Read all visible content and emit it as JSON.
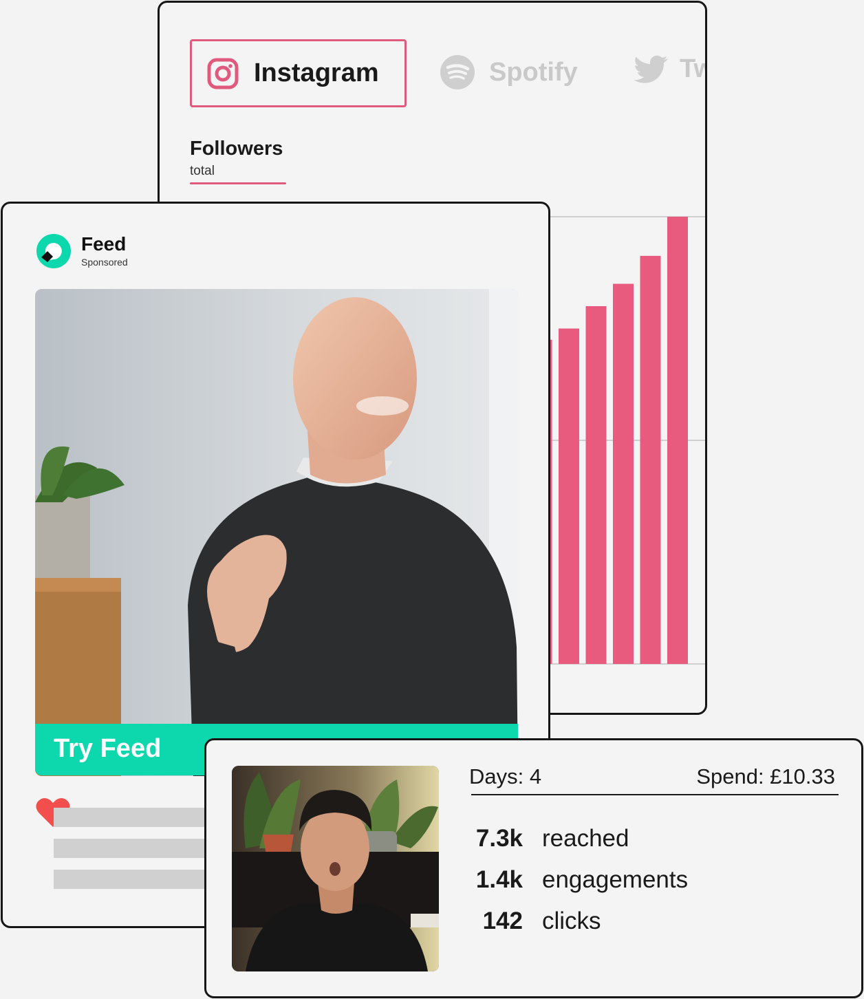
{
  "analytics": {
    "tabs": [
      {
        "label": "Instagram",
        "icon": "instagram-icon",
        "active": true
      },
      {
        "label": "Spotify",
        "icon": "spotify-icon",
        "active": false
      },
      {
        "label": "Tw",
        "icon": "twitter-icon",
        "active": false
      }
    ],
    "metric": {
      "title": "Followers",
      "subtitle": "total"
    },
    "accent_color": "#e05a7e"
  },
  "chart_data": {
    "type": "bar",
    "values": [
      50,
      58,
      60,
      64,
      68,
      73,
      80
    ],
    "ylim": [
      0,
      80
    ],
    "grid": true,
    "bar_color": "#e85a7e"
  },
  "feed": {
    "brand": "Feed",
    "sponsored": "Sponsored",
    "cta_label": "Try Feed",
    "brand_color": "#0dd7ac",
    "heart_color": "#f24e4e"
  },
  "stats": {
    "days_label": "Days: 4",
    "spend_label": "Spend: £10.33",
    "rows": [
      {
        "value": "7.3k",
        "label": "reached"
      },
      {
        "value": "1.4k",
        "label": "engagements"
      },
      {
        "value": "142",
        "label": "clicks"
      }
    ]
  }
}
